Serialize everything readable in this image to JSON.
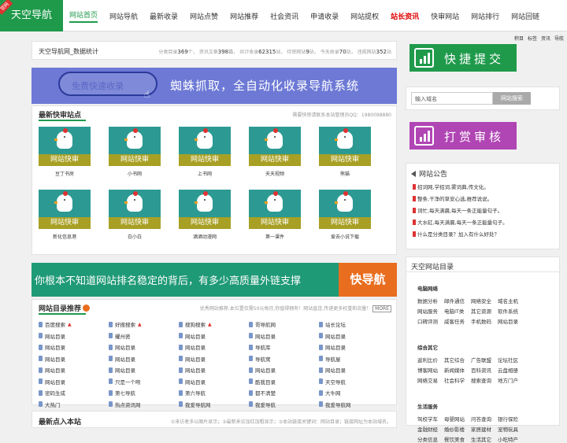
{
  "header": {
    "logo": "天空导航",
    "ribbon": "官网",
    "nav": [
      {
        "label": "网站首页",
        "active": true
      },
      {
        "label": "网站导航"
      },
      {
        "label": "最新收录"
      },
      {
        "label": "网站点赞"
      },
      {
        "label": "网站推荐"
      },
      {
        "label": "社会资讯"
      },
      {
        "label": "申请收录"
      },
      {
        "label": "网站提权"
      },
      {
        "label": "站长资讯",
        "hot": true
      },
      {
        "label": "快审网站"
      },
      {
        "label": "网站排行"
      },
      {
        "label": "网站回链"
      }
    ],
    "user_links": [
      "积目",
      "标签",
      "资讯",
      "导航"
    ]
  },
  "stats": {
    "title": "天空导航网_数据统计",
    "items": [
      {
        "label": "分类目录",
        "value": "369",
        "unit": "个"
      },
      {
        "label": "资讯文章",
        "value": "398",
        "unit": "篇"
      },
      {
        "label": "共计收录",
        "value": "62315",
        "unit": "站"
      },
      {
        "label": "待审网站",
        "value": "9",
        "unit": "站"
      },
      {
        "label": "今天收录",
        "value": "70",
        "unit": "站"
      },
      {
        "label": "违规网站",
        "value": "352",
        "unit": "站"
      }
    ]
  },
  "banner1": {
    "pill": "免费快速收录",
    "text": "蜘蛛抓取，全自动化收录导航系统"
  },
  "new_sites": {
    "title": "最新快审站点",
    "contact": "需要快审请联系本站管理员QQ：1980098880",
    "tile_label": "网站快审",
    "tiles": [
      "豆丁书房",
      "小书网",
      "上书网",
      "天天视频",
      "熊猫",
      "新化信息港",
      "白小白",
      "酒酒动漫网",
      "第一课件",
      "爱去小说下载"
    ]
  },
  "banner2": {
    "text": "你根本不知道网站排名稳定的背后，有多少高质量外链支撑",
    "tag": "快导航"
  },
  "directory": {
    "title": "网站目录推荐",
    "note": "优秀网站推荐,本位置仅需50元每月,你值得拥有！网站直连,传递更多权重和流量！",
    "more": "MORE",
    "columns": [
      [
        "百度搜索",
        "网站目录",
        "网站目录",
        "网站目录",
        "网站目录",
        "网站目录",
        "密码生成",
        "大热门"
      ],
      [
        "好搜搜索",
        "耀州瓷",
        "网站目录",
        "网站目录",
        "网站目录",
        "只是一个吻",
        "第七导航",
        "热点资讯网"
      ],
      [
        "搜狗搜索",
        "网站目录",
        "网站目录",
        "网站目录",
        "网站目录",
        "网站目录",
        "第六导航",
        "我爱导航网"
      ],
      [
        "哥导航网",
        "网站目录",
        "导航库",
        "导航窝",
        "网站目录",
        "酷我目录",
        "都不清楚",
        "我爱导航"
      ],
      [
        "站长论坛",
        "网站目录",
        "网站目录",
        "导航屋",
        "网站目录",
        "天空导航",
        "大牛网",
        "我爱导航网"
      ]
    ],
    "hot_rows": [
      0
    ]
  },
  "latest": {
    "title": "最新点入本站",
    "hint": "①来访者多以图片显示；②最新来访加红加粗显示；③本站链接关键词：网站目录；链接网址为本站域名。"
  },
  "sidebar": {
    "cta1": "快捷提交",
    "cta2": "打赏审核",
    "search_placeholder": "输入域名",
    "search_button": "网站搜索",
    "notice_title": "网站公告",
    "notices": [
      "招词网,学招词,雾词典,传文化。",
      "整条,干净的草安心选,推荐说说。",
      "词忙,每天满晨,每天一条正能量句子。",
      "大水缸,每天满晨,每天一条正能量句子。",
      "什么是分类目录？加入有什么好处？"
    ],
    "catalog_title": "天空网站目录",
    "groups": [
      {
        "title": "电脑网络",
        "items": [
          "数据分析",
          "邮件通信",
          "网络安全",
          "域名主机",
          "网站服务",
          "电脑IT类",
          "其它资源",
          "软件系统",
          "口碑评测",
          "威客任务",
          "手机数码",
          "网站目录"
        ]
      },
      {
        "title": "综合其它",
        "items": [
          "返利比价",
          "其它综合",
          "广告联盟",
          "论坛社区",
          "博客网站",
          "新闻媒体",
          "百科资讯",
          "云盘相册",
          "网络交易",
          "社会科学",
          "搜索查询",
          "地方门户"
        ]
      },
      {
        "title": "生活服务",
        "items": [
          "驾校学车",
          "母婴网站",
          "问答查询",
          "银行保险",
          "金融财经",
          "婚纱影楼",
          "家居建材",
          "宠物玩具",
          "分类信息",
          "餐饮美食",
          "生活其它",
          "小吃特产"
        ]
      }
    ]
  },
  "colors": {
    "brand": "#1f9a4b",
    "cta2": "#b045b4",
    "banner1": "#6d79d5",
    "banner2": "#1f9a76",
    "accent": "#e96d1e",
    "tile_top": "#2c9a93",
    "tile_bottom": "#a8a024"
  }
}
